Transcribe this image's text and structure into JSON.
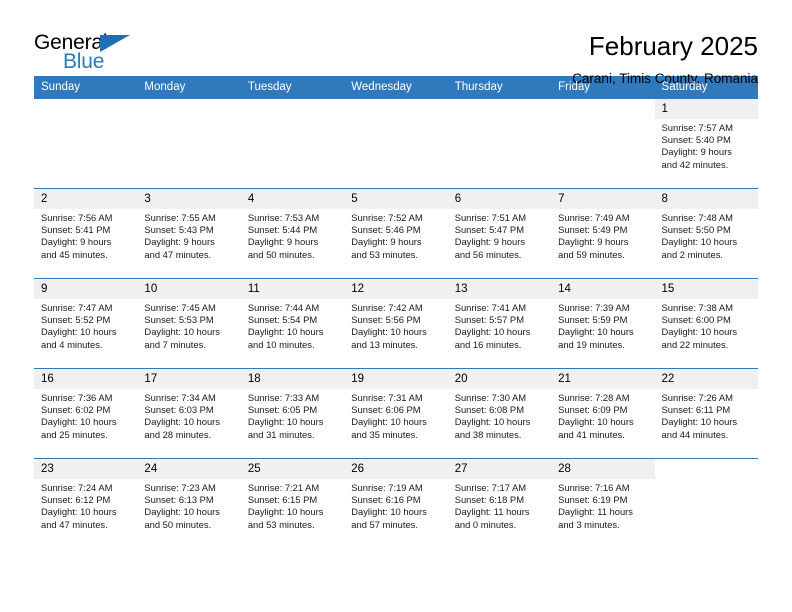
{
  "brand": {
    "name_top": "General",
    "name_bottom": "Blue",
    "accent_color": "#2a7ac0"
  },
  "header": {
    "month_title": "February 2025",
    "location": "Carani, Timis County, Romania"
  },
  "calendar": {
    "header_color": "#3179bd",
    "weekday_headers": [
      "Sunday",
      "Monday",
      "Tuesday",
      "Wednesday",
      "Thursday",
      "Friday",
      "Saturday"
    ],
    "labels": {
      "sunrise": "Sunrise:",
      "sunset": "Sunset:",
      "daylight": "Daylight:"
    },
    "weeks": [
      [
        {
          "date": "",
          "blank": true
        },
        {
          "date": "",
          "blank": true
        },
        {
          "date": "",
          "blank": true
        },
        {
          "date": "",
          "blank": true
        },
        {
          "date": "",
          "blank": true
        },
        {
          "date": "",
          "blank": true
        },
        {
          "date": "1",
          "sunrise": "Sunrise: 7:57 AM",
          "sunset": "Sunset: 5:40 PM",
          "daylight_line1": "Daylight: 9 hours",
          "daylight_line2": "and 42 minutes."
        }
      ],
      [
        {
          "date": "2",
          "sunrise": "Sunrise: 7:56 AM",
          "sunset": "Sunset: 5:41 PM",
          "daylight_line1": "Daylight: 9 hours",
          "daylight_line2": "and 45 minutes."
        },
        {
          "date": "3",
          "sunrise": "Sunrise: 7:55 AM",
          "sunset": "Sunset: 5:43 PM",
          "daylight_line1": "Daylight: 9 hours",
          "daylight_line2": "and 47 minutes."
        },
        {
          "date": "4",
          "sunrise": "Sunrise: 7:53 AM",
          "sunset": "Sunset: 5:44 PM",
          "daylight_line1": "Daylight: 9 hours",
          "daylight_line2": "and 50 minutes."
        },
        {
          "date": "5",
          "sunrise": "Sunrise: 7:52 AM",
          "sunset": "Sunset: 5:46 PM",
          "daylight_line1": "Daylight: 9 hours",
          "daylight_line2": "and 53 minutes."
        },
        {
          "date": "6",
          "sunrise": "Sunrise: 7:51 AM",
          "sunset": "Sunset: 5:47 PM",
          "daylight_line1": "Daylight: 9 hours",
          "daylight_line2": "and 56 minutes."
        },
        {
          "date": "7",
          "sunrise": "Sunrise: 7:49 AM",
          "sunset": "Sunset: 5:49 PM",
          "daylight_line1": "Daylight: 9 hours",
          "daylight_line2": "and 59 minutes."
        },
        {
          "date": "8",
          "sunrise": "Sunrise: 7:48 AM",
          "sunset": "Sunset: 5:50 PM",
          "daylight_line1": "Daylight: 10 hours",
          "daylight_line2": "and 2 minutes."
        }
      ],
      [
        {
          "date": "9",
          "sunrise": "Sunrise: 7:47 AM",
          "sunset": "Sunset: 5:52 PM",
          "daylight_line1": "Daylight: 10 hours",
          "daylight_line2": "and 4 minutes."
        },
        {
          "date": "10",
          "sunrise": "Sunrise: 7:45 AM",
          "sunset": "Sunset: 5:53 PM",
          "daylight_line1": "Daylight: 10 hours",
          "daylight_line2": "and 7 minutes."
        },
        {
          "date": "11",
          "sunrise": "Sunrise: 7:44 AM",
          "sunset": "Sunset: 5:54 PM",
          "daylight_line1": "Daylight: 10 hours",
          "daylight_line2": "and 10 minutes."
        },
        {
          "date": "12",
          "sunrise": "Sunrise: 7:42 AM",
          "sunset": "Sunset: 5:56 PM",
          "daylight_line1": "Daylight: 10 hours",
          "daylight_line2": "and 13 minutes."
        },
        {
          "date": "13",
          "sunrise": "Sunrise: 7:41 AM",
          "sunset": "Sunset: 5:57 PM",
          "daylight_line1": "Daylight: 10 hours",
          "daylight_line2": "and 16 minutes."
        },
        {
          "date": "14",
          "sunrise": "Sunrise: 7:39 AM",
          "sunset": "Sunset: 5:59 PM",
          "daylight_line1": "Daylight: 10 hours",
          "daylight_line2": "and 19 minutes."
        },
        {
          "date": "15",
          "sunrise": "Sunrise: 7:38 AM",
          "sunset": "Sunset: 6:00 PM",
          "daylight_line1": "Daylight: 10 hours",
          "daylight_line2": "and 22 minutes."
        }
      ],
      [
        {
          "date": "16",
          "sunrise": "Sunrise: 7:36 AM",
          "sunset": "Sunset: 6:02 PM",
          "daylight_line1": "Daylight: 10 hours",
          "daylight_line2": "and 25 minutes."
        },
        {
          "date": "17",
          "sunrise": "Sunrise: 7:34 AM",
          "sunset": "Sunset: 6:03 PM",
          "daylight_line1": "Daylight: 10 hours",
          "daylight_line2": "and 28 minutes."
        },
        {
          "date": "18",
          "sunrise": "Sunrise: 7:33 AM",
          "sunset": "Sunset: 6:05 PM",
          "daylight_line1": "Daylight: 10 hours",
          "daylight_line2": "and 31 minutes."
        },
        {
          "date": "19",
          "sunrise": "Sunrise: 7:31 AM",
          "sunset": "Sunset: 6:06 PM",
          "daylight_line1": "Daylight: 10 hours",
          "daylight_line2": "and 35 minutes."
        },
        {
          "date": "20",
          "sunrise": "Sunrise: 7:30 AM",
          "sunset": "Sunset: 6:08 PM",
          "daylight_line1": "Daylight: 10 hours",
          "daylight_line2": "and 38 minutes."
        },
        {
          "date": "21",
          "sunrise": "Sunrise: 7:28 AM",
          "sunset": "Sunset: 6:09 PM",
          "daylight_line1": "Daylight: 10 hours",
          "daylight_line2": "and 41 minutes."
        },
        {
          "date": "22",
          "sunrise": "Sunrise: 7:26 AM",
          "sunset": "Sunset: 6:11 PM",
          "daylight_line1": "Daylight: 10 hours",
          "daylight_line2": "and 44 minutes."
        }
      ],
      [
        {
          "date": "23",
          "sunrise": "Sunrise: 7:24 AM",
          "sunset": "Sunset: 6:12 PM",
          "daylight_line1": "Daylight: 10 hours",
          "daylight_line2": "and 47 minutes."
        },
        {
          "date": "24",
          "sunrise": "Sunrise: 7:23 AM",
          "sunset": "Sunset: 6:13 PM",
          "daylight_line1": "Daylight: 10 hours",
          "daylight_line2": "and 50 minutes."
        },
        {
          "date": "25",
          "sunrise": "Sunrise: 7:21 AM",
          "sunset": "Sunset: 6:15 PM",
          "daylight_line1": "Daylight: 10 hours",
          "daylight_line2": "and 53 minutes."
        },
        {
          "date": "26",
          "sunrise": "Sunrise: 7:19 AM",
          "sunset": "Sunset: 6:16 PM",
          "daylight_line1": "Daylight: 10 hours",
          "daylight_line2": "and 57 minutes."
        },
        {
          "date": "27",
          "sunrise": "Sunrise: 7:17 AM",
          "sunset": "Sunset: 6:18 PM",
          "daylight_line1": "Daylight: 11 hours",
          "daylight_line2": "and 0 minutes."
        },
        {
          "date": "28",
          "sunrise": "Sunrise: 7:16 AM",
          "sunset": "Sunset: 6:19 PM",
          "daylight_line1": "Daylight: 11 hours",
          "daylight_line2": "and 3 minutes."
        },
        {
          "date": "",
          "blank": true
        }
      ]
    ]
  }
}
